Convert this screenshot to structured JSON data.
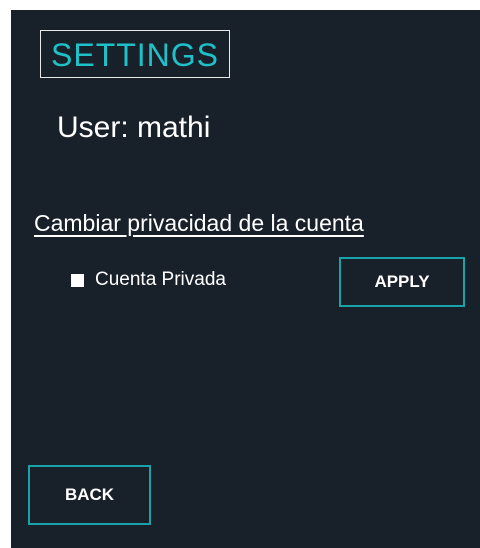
{
  "settings": {
    "title": "SETTINGS",
    "user_label": "User: mathi",
    "privacy_heading": "Cambiar privacidad de la cuenta",
    "private_account_label": "Cuenta Privada",
    "private_account_checked": false,
    "apply_label": "APPLY",
    "back_label": "BACK"
  },
  "colors": {
    "panel_background": "#18202a",
    "title_accent": "#1fc1c9",
    "button_border": "#1aa2a8",
    "text": "#ffffff"
  }
}
